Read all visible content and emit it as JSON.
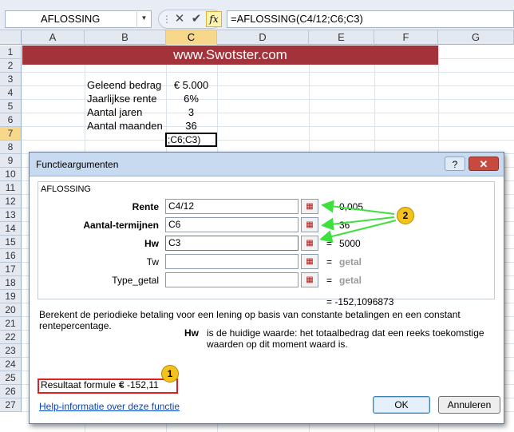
{
  "formula_bar": {
    "name_box": "AFLOSSING",
    "cancel_icon": "✕",
    "confirm_icon": "✔",
    "fx_label": "fx",
    "formula": "=AFLOSSING(C4/12;C6;C3)"
  },
  "grid": {
    "columns": [
      "A",
      "B",
      "C",
      "D",
      "E",
      "F",
      "G"
    ],
    "rows": [
      "1",
      "2",
      "3",
      "4",
      "5",
      "6",
      "7",
      "8",
      "9",
      "10",
      "11",
      "12",
      "13",
      "14",
      "15",
      "16",
      "17",
      "18",
      "19",
      "20",
      "21",
      "22",
      "23",
      "24",
      "25",
      "26",
      "27"
    ],
    "selected_column": "C",
    "selected_row": "7",
    "banner": "www.Swotster.com",
    "cells": [
      {
        "label": "Geleend bedrag",
        "value": "€ 5.000"
      },
      {
        "label": "Jaarlijkse rente",
        "value": "6%"
      },
      {
        "label": "Aantal jaren",
        "value": "3"
      },
      {
        "label": "Aantal maanden",
        "value": "36"
      }
    ],
    "active_cell_text": ";C6;C3)"
  },
  "dialog": {
    "title": "Functieargumenten",
    "help_button": "?",
    "close_button": "✕",
    "function_name": "AFLOSSING",
    "args": [
      {
        "label": "Rente",
        "input": "C4/12",
        "value": "0,005"
      },
      {
        "label": "Aantal-termijnen",
        "input": "C6",
        "value": "36"
      },
      {
        "label": "Hw",
        "input": "C3",
        "value": "5000"
      },
      {
        "label": "Tw",
        "input": "",
        "value": "getal"
      },
      {
        "label": "Type_getal",
        "input": "",
        "value": "getal"
      }
    ],
    "equals": "=",
    "return_value": "= -152,1096873",
    "description": "Berekent de periodieke betaling voor een lening op basis van constante betalingen en een constant rentepercentage.",
    "hw_label": "Hw",
    "hw_description": "is de huidige waarde: het totaalbedrag dat een reeks toekomstige waarden op dit moment waard is.",
    "result_label": "Resultaat formule =",
    "result_value": "€ -152,11",
    "help_link": "Help-informatie over deze functie",
    "ok_button": "OK",
    "cancel_button": "Annuleren"
  },
  "callouts": {
    "badge_1": "1",
    "badge_2": "2",
    "arrow_color": "#3ee03e",
    "badge_color": "#f4c21c",
    "highlight_color": "#e02020"
  },
  "colors": {
    "banner_bg": "#a3333a",
    "selected_header": "#f7d88a"
  }
}
